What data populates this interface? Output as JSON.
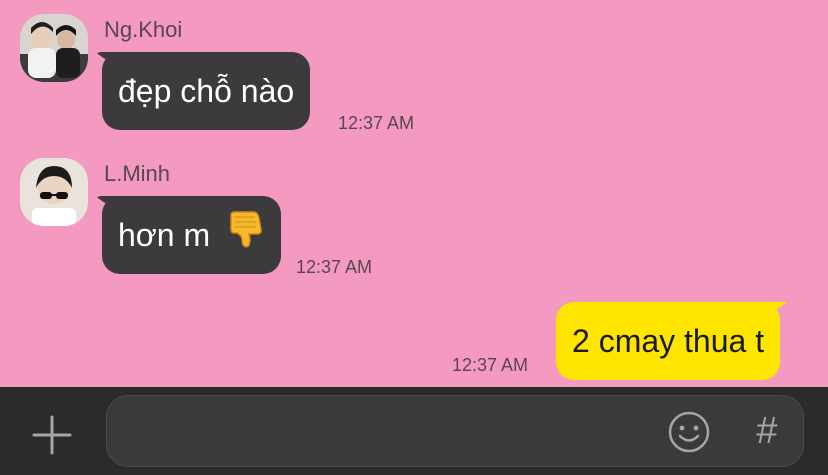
{
  "messages": [
    {
      "sender": "Ng.Khoi",
      "text": "đẹp chỗ nào",
      "time": "12:37 AM",
      "direction": "incoming"
    },
    {
      "sender": "L.Minh",
      "text": "hơn m",
      "emoji": "thumbs-down",
      "time": "12:37 AM",
      "direction": "incoming"
    },
    {
      "text": "2 cmay thua t",
      "time": "12:37 AM",
      "direction": "outgoing"
    }
  ],
  "input_bar": {
    "placeholder": "",
    "value": "",
    "hash_label": "#",
    "plus_icon": "plus-icon",
    "emoji_icon": "smiley-icon"
  },
  "colors": {
    "background": "#f49ac1",
    "incoming_bubble": "#3c3a3c",
    "outgoing_bubble": "#fee500",
    "input_bar": "#2b2b2b"
  }
}
